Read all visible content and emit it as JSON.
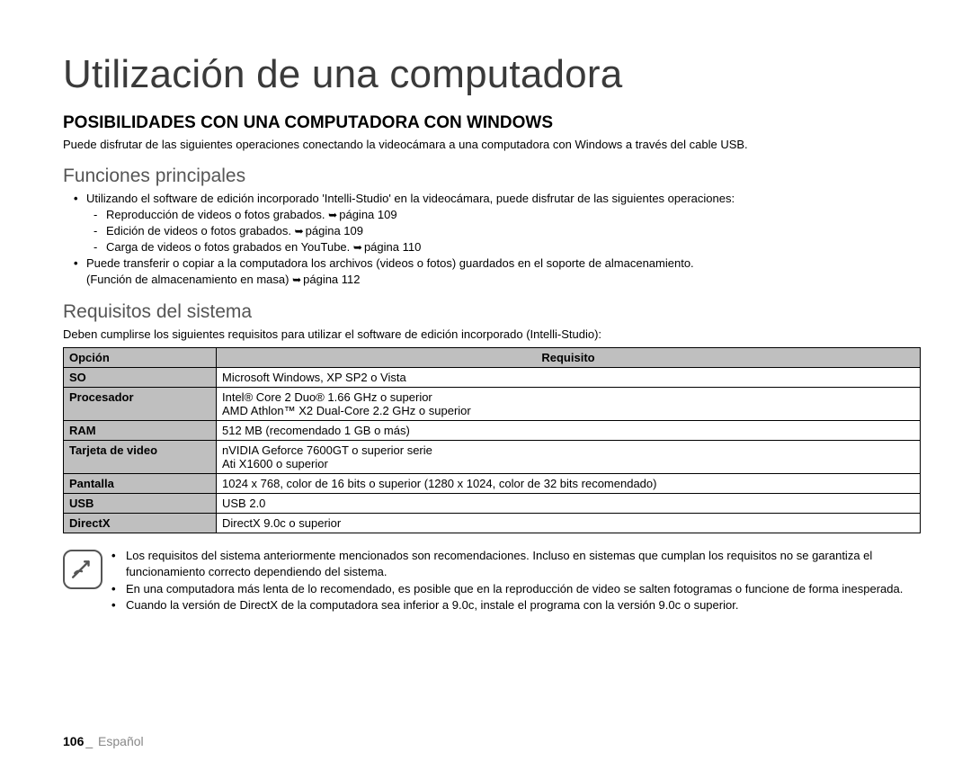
{
  "title": "Utilización de una computadora",
  "section1": {
    "heading": "POSIBILIDADES CON UNA COMPUTADORA CON WINDOWS",
    "intro": "Puede disfrutar de las siguientes operaciones conectando la videocámara a una computadora con Windows a través del cable USB."
  },
  "functions": {
    "heading": "Funciones principales",
    "bullet1": "Utilizando el software de edición incorporado 'Intelli-Studio' en la videocámara, puede disfrutar de las siguientes operaciones:",
    "sub1": "Reproducción de videos o fotos grabados. ",
    "sub1_ref": "página 109",
    "sub2": "Edición de videos o fotos grabados. ",
    "sub2_ref": "página 109",
    "sub3": "Carga de videos o fotos grabados en YouTube. ",
    "sub3_ref": "página 110",
    "bullet2": "Puede transferir o copiar a la computadora los archivos (videos o fotos) guardados en el soporte de almacenamiento.",
    "bullet2_line2": "(Función de almacenamiento en masa) ",
    "bullet2_ref": "página 112"
  },
  "requirements": {
    "heading": "Requisitos del sistema",
    "desc": "Deben cumplirse los siguientes requisitos para utilizar el software de edición incorporado (Intelli-Studio):",
    "header_col1": "Opción",
    "header_col2": "Requisito",
    "rows": {
      "r0_label": "SO",
      "r0_val": "Microsoft Windows, XP SP2 o Vista",
      "r1_label": "Procesador",
      "r1_val_l1": "Intel® Core 2 Duo® 1.66 GHz o superior",
      "r1_val_l2": "AMD Athlon™ X2 Dual-Core 2.2 GHz  o superior",
      "r2_label": "RAM",
      "r2_val": "512 MB (recomendado 1 GB o más)",
      "r3_label": "Tarjeta de video",
      "r3_val_l1": "nVIDIA Geforce 7600GT o superior serie",
      "r3_val_l2": "Ati X1600 o superior",
      "r4_label": "Pantalla",
      "r4_val": "1024 x 768, color de 16 bits o superior (1280 x 1024, color de 32 bits recomendado)",
      "r5_label": "USB",
      "r5_val": "USB 2.0",
      "r6_label": "DirectX",
      "r6_val": "DirectX 9.0c o superior"
    }
  },
  "notes": {
    "n1": "Los requisitos del sistema anteriormente mencionados son recomendaciones. Incluso en sistemas que cumplan los requisitos no se garantiza el funcionamiento correcto dependiendo del sistema.",
    "n2": "En una computadora más lenta de lo recomendado, es posible que en la reproducción de video se salten fotogramas o funcione de forma inesperada.",
    "n3": "Cuando la versión de DirectX de la computadora sea inferior a 9.0c, instale el programa con la versión 9.0c o superior."
  },
  "footer": {
    "page_number": "106",
    "separator": "_",
    "language": "Español"
  }
}
